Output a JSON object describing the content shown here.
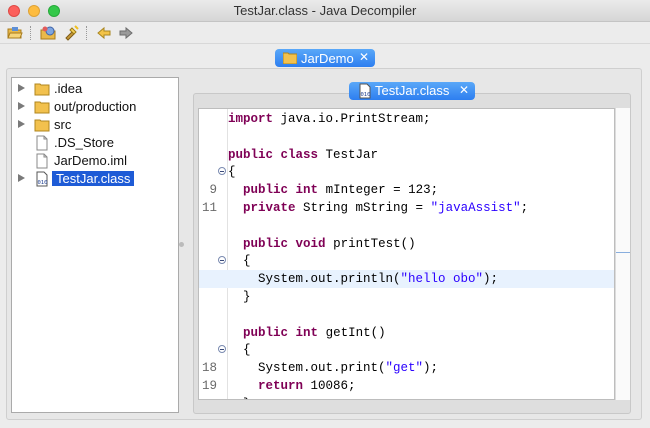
{
  "window": {
    "title": "TestJar.class - Java Decompiler"
  },
  "toolbar": {
    "buttons": [
      {
        "name": "open-file",
        "icon": "folder-open-icon"
      },
      {
        "name": "open-type",
        "icon": "package-icon"
      },
      {
        "name": "search",
        "icon": "flashlight-icon"
      },
      {
        "name": "back",
        "icon": "arrow-left-icon"
      },
      {
        "name": "forward",
        "icon": "arrow-right-icon"
      }
    ]
  },
  "outer_tab": {
    "label": "JarDemo",
    "icon": "folder-icon",
    "close": "✕"
  },
  "tree": {
    "items": [
      {
        "label": ".idea",
        "type": "folder",
        "expandable": true,
        "selected": false
      },
      {
        "label": "out/production",
        "type": "folder",
        "expandable": true,
        "selected": false
      },
      {
        "label": "src",
        "type": "folder",
        "expandable": true,
        "selected": false
      },
      {
        "label": ".DS_Store",
        "type": "file",
        "expandable": false,
        "selected": false
      },
      {
        "label": "JarDemo.iml",
        "type": "file",
        "expandable": false,
        "selected": false
      },
      {
        "label": "TestJar.class",
        "type": "class-file",
        "expandable": true,
        "selected": true
      }
    ]
  },
  "inner_tab": {
    "label": "TestJar.class",
    "icon": "class-file-icon",
    "close": "✕"
  },
  "editor": {
    "lines": [
      {
        "ln": "",
        "fold": false,
        "text": "import java.io.PrintStream;"
      },
      {
        "ln": "",
        "fold": false,
        "text": ""
      },
      {
        "ln": "",
        "fold": false,
        "text": "public class TestJar"
      },
      {
        "ln": "",
        "fold": true,
        "text": "{"
      },
      {
        "ln": "9",
        "fold": false,
        "text": "  public int mInteger = 123;"
      },
      {
        "ln": "11",
        "fold": false,
        "text": "  private String mString = \"javaAssist\";"
      },
      {
        "ln": "",
        "fold": false,
        "text": ""
      },
      {
        "ln": "",
        "fold": false,
        "text": "  public void printTest()"
      },
      {
        "ln": "",
        "fold": true,
        "text": "  {"
      },
      {
        "ln": "",
        "fold": false,
        "text": "    System.out.println(\"hello obo\");",
        "highlight": true
      },
      {
        "ln": "",
        "fold": false,
        "text": "  }"
      },
      {
        "ln": "",
        "fold": false,
        "text": ""
      },
      {
        "ln": "",
        "fold": false,
        "text": "  public int getInt()"
      },
      {
        "ln": "",
        "fold": true,
        "text": "  {"
      },
      {
        "ln": "18",
        "fold": false,
        "text": "    System.out.print(\"get\");"
      },
      {
        "ln": "19",
        "fold": false,
        "text": "    return 10086;"
      },
      {
        "ln": "",
        "fold": false,
        "text": "  }"
      },
      {
        "ln": "",
        "fold": false,
        "text": "}"
      }
    ]
  },
  "colors": {
    "keyword": "#7f0055",
    "string": "#2a00ff",
    "selection": "#1e5bd6",
    "tab_accent": "#2d7ef0",
    "line_highlight": "#e8f2fe"
  }
}
